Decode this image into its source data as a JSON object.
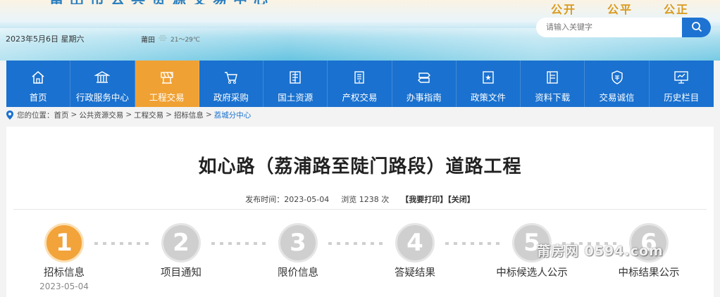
{
  "header": {
    "slogans": [
      "公开",
      "公平",
      "公正"
    ],
    "date": "2023年5月6日 星期六",
    "weather_city": "莆田",
    "weather_temp": "21～29℃",
    "search_placeholder": "请输入关键字"
  },
  "nav": [
    {
      "label": "首页",
      "icon": "home-icon"
    },
    {
      "label": "行政服务中心",
      "icon": "building-icon"
    },
    {
      "label": "工程交易",
      "icon": "construction-icon",
      "active": true
    },
    {
      "label": "政府采购",
      "icon": "cart-icon"
    },
    {
      "label": "国土资源",
      "icon": "land-icon"
    },
    {
      "label": "产权交易",
      "icon": "document-icon"
    },
    {
      "label": "办事指南",
      "icon": "signpost-icon"
    },
    {
      "label": "政策文件",
      "icon": "policy-icon"
    },
    {
      "label": "资料下载",
      "icon": "download-icon"
    },
    {
      "label": "交易诚信",
      "icon": "shield-icon"
    },
    {
      "label": "历史栏目",
      "icon": "monitor-icon"
    }
  ],
  "breadcrumb": {
    "prefix": "您的位置：",
    "items": [
      "首页",
      "公共资源交易",
      "工程交易",
      "招标信息",
      "荔城分中心"
    ]
  },
  "article": {
    "title": "如心路（荔浦路至陡门路段）道路工程",
    "publish_label": "发布时间：",
    "publish_date": "2023-05-04",
    "views_label": "浏览",
    "views": "1238",
    "views_unit": "次",
    "print": "【我要打印】",
    "close": "【关闭】"
  },
  "steps": [
    {
      "num": "1",
      "label": "招标信息",
      "date": "2023-05-04",
      "active": true
    },
    {
      "num": "2",
      "label": "项目通知"
    },
    {
      "num": "3",
      "label": "限价信息"
    },
    {
      "num": "4",
      "label": "答疑结果"
    },
    {
      "num": "5",
      "label": "中标候选人公示"
    },
    {
      "num": "6",
      "label": "中标结果公示"
    }
  ],
  "watermark": "莆房网 0594.com"
}
